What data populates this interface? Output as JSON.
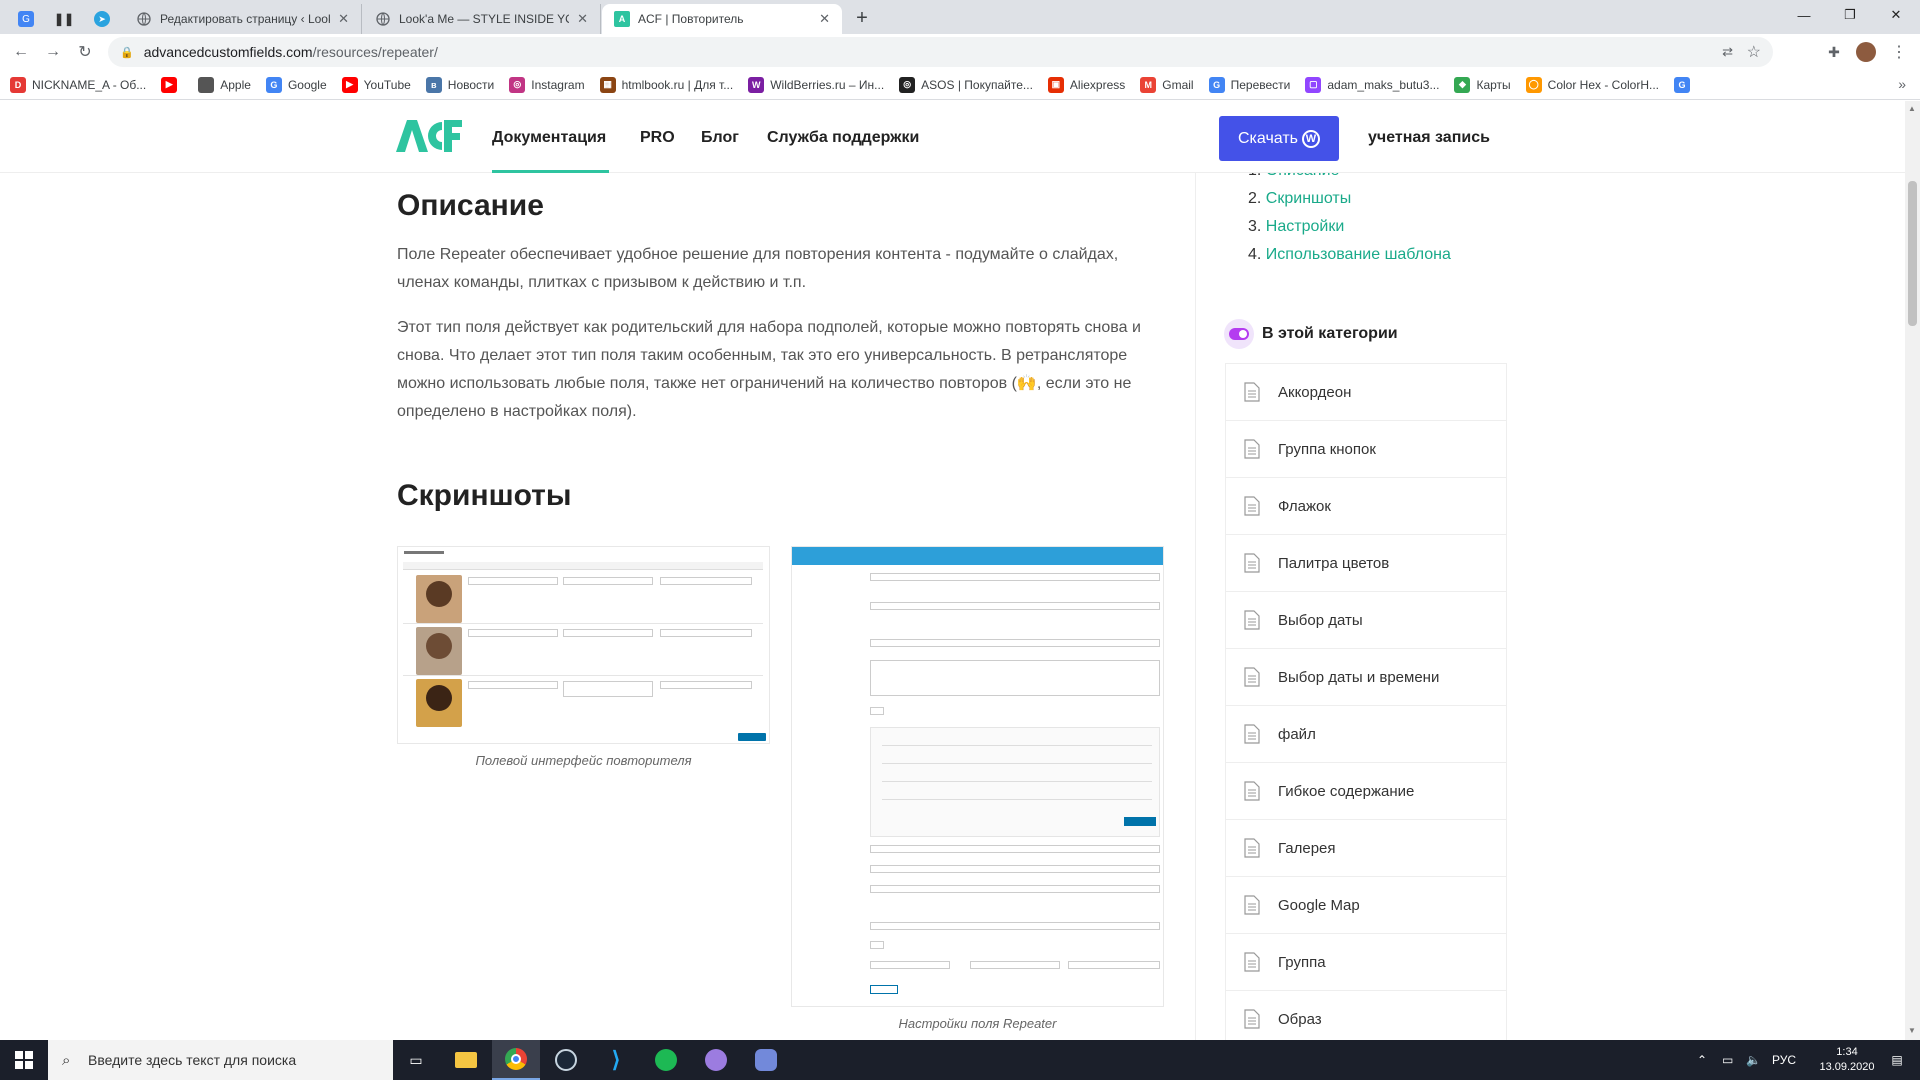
{
  "browser": {
    "pinned_tabs": [
      "translate-icon",
      "pause-icon",
      "telegram-icon"
    ],
    "tabs": [
      {
        "title": "Редактировать страницу ‹ Look",
        "active": false
      },
      {
        "title": "Look'a Me — STYLE INSIDE YOU",
        "active": false
      },
      {
        "title": "ACF | Повторитель",
        "active": true
      }
    ],
    "new_tab_label": "+",
    "url_host": "advancedcustomfields.com",
    "url_path": "/resources/repeater/",
    "bookmarks": [
      {
        "label": "NICKNAME_A - Об...",
        "icon": "D",
        "color": "#e53935"
      },
      {
        "label": "",
        "icon": "▶",
        "color": "#ff0000"
      },
      {
        "label": "Apple",
        "icon": "",
        "color": "#555555"
      },
      {
        "label": "Google",
        "icon": "G",
        "color": "#4285f4"
      },
      {
        "label": "YouTube",
        "icon": "▶",
        "color": "#ff0000"
      },
      {
        "label": "Новости",
        "icon": "в",
        "color": "#4a76a8"
      },
      {
        "label": "Instagram",
        "icon": "◎",
        "color": "#c13584"
      },
      {
        "label": "htmlbook.ru | Для т...",
        "icon": "▦",
        "color": "#8b4513"
      },
      {
        "label": "WildBerries.ru – Ин...",
        "icon": "W",
        "color": "#7b1fa2"
      },
      {
        "label": "ASOS | Покупайте...",
        "icon": "◎",
        "color": "#222222"
      },
      {
        "label": "Aliexpress",
        "icon": "▣",
        "color": "#e62e04"
      },
      {
        "label": "Gmail",
        "icon": "M",
        "color": "#ea4335"
      },
      {
        "label": "Перевести",
        "icon": "G",
        "color": "#4285f4"
      },
      {
        "label": "adam_maks_butu3...",
        "icon": "▢",
        "color": "#9146ff"
      },
      {
        "label": "Карты",
        "icon": "◆",
        "color": "#34a853"
      },
      {
        "label": "Color Hex - ColorH...",
        "icon": "◯",
        "color": "#ff9800"
      },
      {
        "label": "",
        "icon": "G",
        "color": "#4285f4"
      }
    ],
    "bookmarks_overflow": "»"
  },
  "site": {
    "logo": "ACF",
    "menu": [
      "Документация",
      "PRO",
      "Блог",
      "Служба поддержки"
    ],
    "download_label": "Скачать",
    "account_label": "учетная запись"
  },
  "content": {
    "description_heading": "Описание",
    "p1": "Поле Repeater обеспечивает удобное решение для повторения контента - подумайте о слайдах, членах команды, плитках с призывом к действию и т.п.",
    "p2": "Этот тип поля действует как родительский для набора подполей, которые можно повторять снова и снова. Что делает этот тип поля таким особенным, так это его универсальность. В ретрансляторе можно использовать любые поля, также нет ограничений на количество повторов (🙌, если это не определено в настройках поля).",
    "screens_heading": "Скриншоты",
    "caption1": "Полевой интерфейс повторителя",
    "caption2": "Настройки поля Repeater"
  },
  "sidebar": {
    "toc": [
      {
        "num": "1.",
        "label": "Описание"
      },
      {
        "num": "2.",
        "label": "Скриншоты"
      },
      {
        "num": "3.",
        "label": "Настройки"
      },
      {
        "num": "4.",
        "label": "Использование шаблона"
      }
    ],
    "category_title": "В этой категории",
    "items": [
      "Аккордеон",
      "Группа кнопок",
      "Флажок",
      "Палитра цветов",
      "Выбор даты",
      "Выбор даты и времени",
      "файл",
      "Гибкое содержание",
      "Галерея",
      "Google Map",
      "Группа",
      "Образ"
    ]
  },
  "taskbar": {
    "search_placeholder": "Введите здесь текст для поиска",
    "lang": "РУС",
    "time": "1:34",
    "date": "13.09.2020"
  }
}
